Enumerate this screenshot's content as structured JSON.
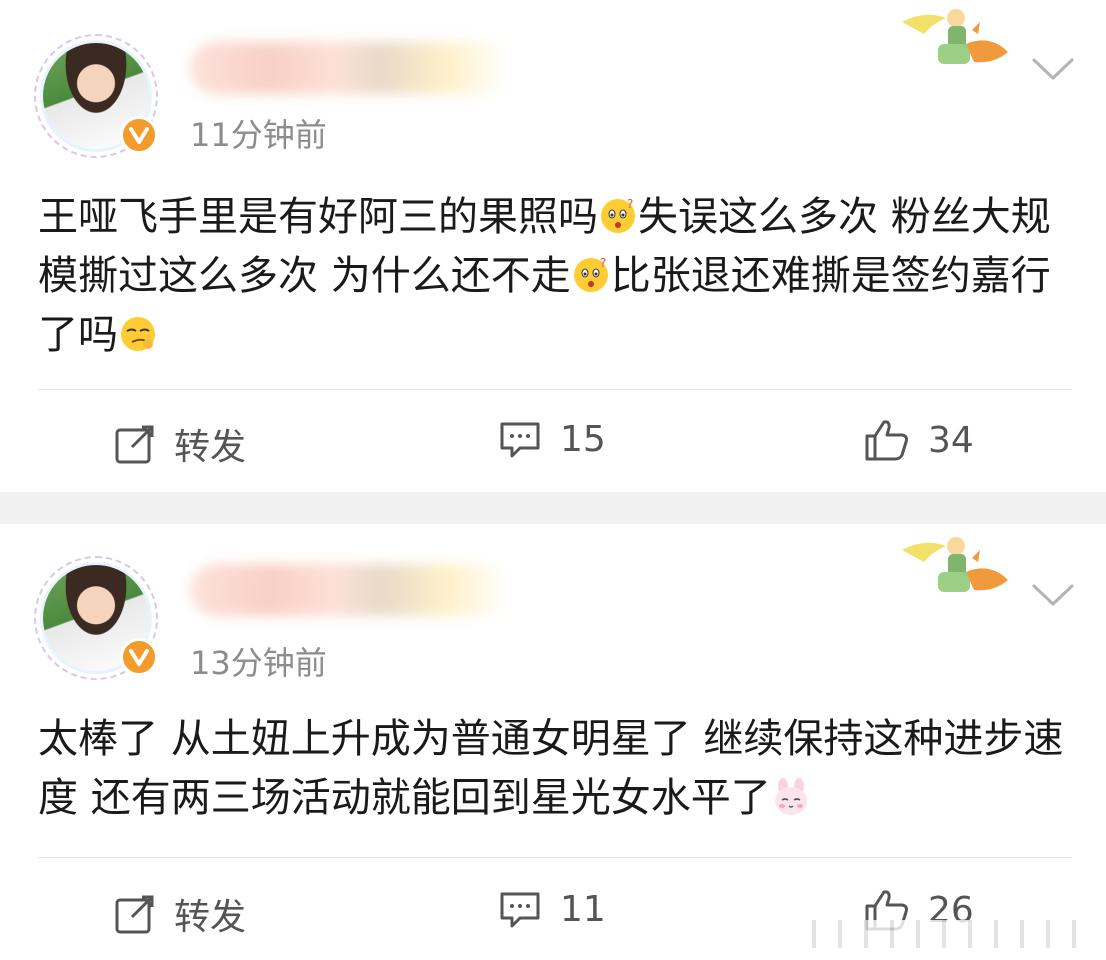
{
  "posts": [
    {
      "time": "11分钟前",
      "content_parts": [
        "王哑飞手里是有好阿三的果照吗",
        "失误这么多次 粉丝大规模撕过这么多次 为什么还不走",
        "比张退还难撕是签约嘉行了吗"
      ],
      "emojis": [
        "thinking-face-emoji",
        "thinking-face-emoji",
        "smirk-face-emoji"
      ],
      "actions": {
        "repost": "转发",
        "comments": "15",
        "likes": "34"
      }
    },
    {
      "time": "13分钟前",
      "content_parts": [
        "太棒了 从土妞上升成为普通女明星了 继续保持这种进步速度 还有两三场活动就能回到星光女水平了"
      ],
      "emojis": [
        "bunny-face-emoji"
      ],
      "actions": {
        "repost": "转发",
        "comments": "11",
        "likes": "26"
      }
    }
  ],
  "colors": {
    "verified_badge": "#f39b2b",
    "text_primary": "#1a1a1a",
    "text_secondary": "#8c8c8c",
    "separator_bg": "#f1f1f1"
  }
}
